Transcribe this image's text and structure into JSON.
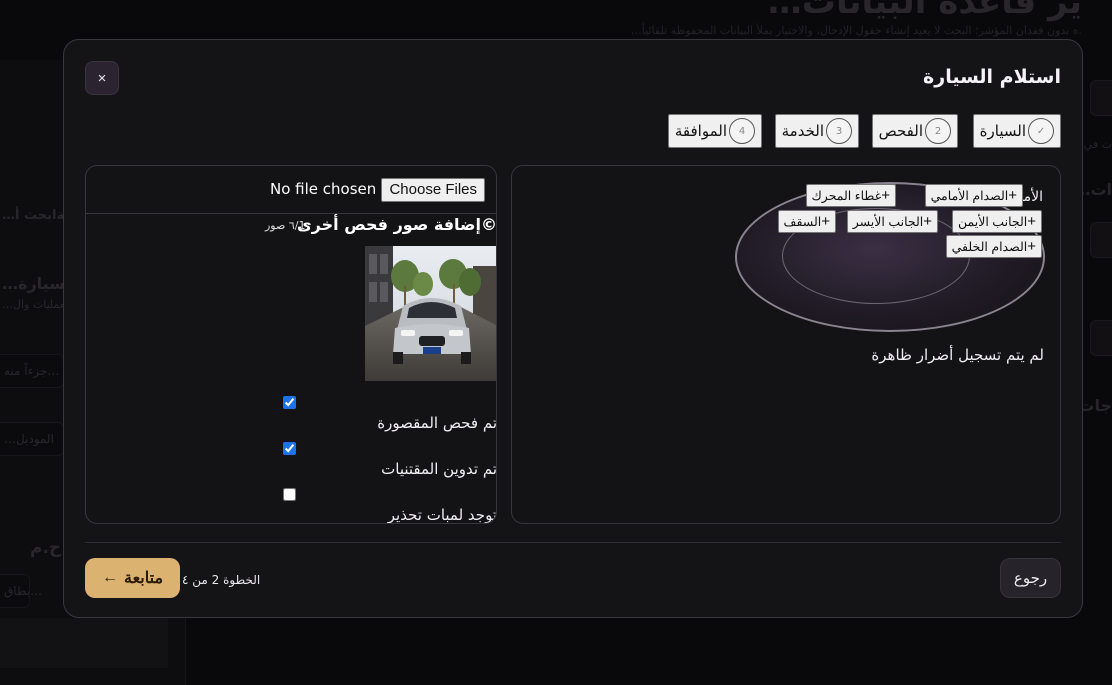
{
  "background": {
    "title": "…ير قاعدة البيانات",
    "subtitle": "…ه بدون فقدان المؤشر؛ البحث لا يعيد إنشاء حقول الإدخال، والاختيار يملأ البيانات المحفوظة تلقائياً.",
    "sidebar": {
      "line1": "…رعةابحث أ",
      "line2": "…والسيارة",
      "line3": "…العمليات وال",
      "search_placeholder": "جزءاً منه…",
      "model_placeholder": "…الموديل",
      "section": "ح.م",
      "card_label": "بطاق…"
    },
    "right_edge": {
      "text1": "…ت في",
      "text2": "…ات",
      "text3": "…جات"
    }
  },
  "modal": {
    "title": "استلام السيارة",
    "close_label": "×",
    "steps": [
      {
        "number": "✓",
        "label": "السيارة"
      },
      {
        "number": "2",
        "label": "الفحص"
      },
      {
        "number": "3",
        "label": "الخدمة"
      },
      {
        "number": "4",
        "label": "الموافقة"
      }
    ],
    "damage_map": {
      "front_label": "الأمام",
      "parts": {
        "front_bumper": "الصدام الأمامي",
        "hood": "غطاء المحرك",
        "right_side": "الجانب الأيمن",
        "left_side": "الجانب الأيسر",
        "roof": "السقف",
        "rear_bumper": "الصدام الخلفي"
      },
      "plus_sign": "+",
      "no_damage_text": "لم يتم تسجيل أضرار ظاهرة"
    },
    "photos": {
      "choose_files_label": "Choose Files",
      "file_status": "No file chosen",
      "add_photos_label": "©إضافة صور فحص أخرى",
      "photo_count": "1/٦ صور",
      "checks": [
        {
          "label": "تم فحص المقصورة",
          "checked": true
        },
        {
          "label": "تم تدوين المقتنيات",
          "checked": true
        },
        {
          "label": "توجد لمبات تحذير",
          "checked": false
        }
      ]
    },
    "footer": {
      "back_label": "رجوع",
      "continue_label": "متابعة",
      "continue_arrow": "←",
      "step_indicator": "الخطوة 2 من ٤"
    }
  }
}
